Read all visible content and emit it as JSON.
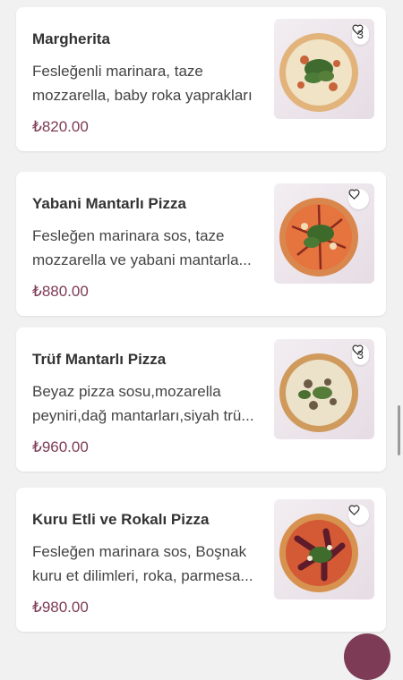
{
  "menu": {
    "items": [
      {
        "name": "Margherita",
        "desc_line1": "Fesleğenli marinara, taze",
        "desc_line2": "mozzarella, baby roka yaprakları",
        "price": "₺820.00",
        "fav_count": "3"
      },
      {
        "name": "Yabani Mantarlı Pizza",
        "desc_line1": "Fesleğen marinara sos, taze",
        "desc_line2": "mozzarella ve yabani mantarla...",
        "price": "₺880.00",
        "fav_count": ""
      },
      {
        "name": "Trüf Mantarlı Pizza",
        "desc_line1": "Beyaz pizza sosu,mozarella",
        "desc_line2": "peyniri,dağ mantarları,siyah trü...",
        "price": "₺960.00",
        "fav_count": "3"
      },
      {
        "name": "Kuru Etli ve Rokalı Pizza",
        "desc_line1": "Fesleğen marinara sos, Boşnak",
        "desc_line2": "kuru et dilimleri, roka, parmesa...",
        "price": "₺980.00",
        "fav_count": ""
      }
    ]
  },
  "colors": {
    "accent": "#7d3b55",
    "background": "#f1f1f1",
    "card": "#ffffff"
  },
  "icons": {
    "favorite": "heart-icon"
  }
}
